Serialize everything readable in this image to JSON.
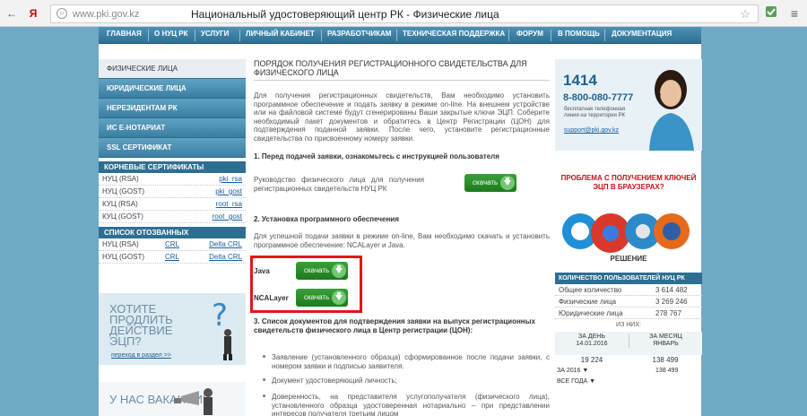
{
  "browser": {
    "back": "←",
    "ya": "Я",
    "url": "www.pki.gov.kz",
    "title": "Национальный удостоверяющий центр РК - Физические лица",
    "star": "☆",
    "menu": "≡"
  },
  "topnav": [
    "ГЛАВНАЯ",
    "О НУЦ РК",
    "УСЛУГИ",
    "ЛИЧНЫЙ КАБИНЕТ",
    "РАЗРАБОТЧИКАМ",
    "ТЕХНИЧЕСКАЯ ПОДДЕРЖКА",
    "ФОРУМ",
    "В ПОМОЩЬ",
    "ДОКУМЕНТАЦИЯ"
  ],
  "sidebar": {
    "menu": [
      "ФИЗИЧЕСКИЕ ЛИЦА",
      "ЮРИДИЧЕСКИЕ ЛИЦА",
      "НЕРЕЗИДЕНТАМ РК",
      "ИС Е-НОТАРИАТ",
      "SSL СЕРТИФИКАТ"
    ],
    "root_title": "КОРНЕВЫЕ СЕРТИФИКАТЫ",
    "root": [
      {
        "name": "НУЦ (RSA)",
        "link": "pki_rsa"
      },
      {
        "name": "НУЦ (GOST)",
        "link": "pki_gost"
      },
      {
        "name": "КУЦ (RSA)",
        "link": "root_rsa"
      },
      {
        "name": "КУЦ (GOST)",
        "link": "root_gost"
      }
    ],
    "revoked_title": "СПИСОК ОТОЗВАННЫХ СЕРТИФИКАТОВ",
    "revoked": [
      {
        "name": "НУЦ (RSA)",
        "crl": "CRL",
        "delta": "Delta CRL"
      },
      {
        "name": "НУЦ (GOST)",
        "crl": "CRL",
        "delta": "Delta CRL"
      }
    ],
    "promo1": {
      "text": "ХОТИТЕ ПРОДЛИТЬ ДЕЙСТВИЕ ЭЦП?",
      "link": "переход в раздел >>"
    },
    "promo2": {
      "text": "У НАС ВАКАНСИИ"
    }
  },
  "main": {
    "title": "ПОРЯДОК ПОЛУЧЕНИЯ РЕГИСТРАЦИОННОГО СВИДЕТЕЛЬСТВА ДЛЯ ФИЗИЧЕСКОГО ЛИЦА",
    "intro": "Для получения регистрационных свидетельств, Вам необходимо установить программное обеспечение и подать заявку в режиме on-line. На внешнем устройстве или на файловой системе будут сгенерированы Ваши закрытые ключи ЭЦП. Соберите необходимый пакет документов и обратитесь в Центр Регистрации (ЦОН) для подтверждения поданной заявки. После чего, установите регистрационные свидетельства по присвоенному номеру заявки.",
    "step1_title": "1. Перед подачей заявки, ознакомьтесь с инструкцией пользователя",
    "step1_text": "Руководство физического лица для получения регистрационных свидетельств НУЦ РК",
    "download_label": "скачать",
    "step2_title": "2. Установка программного обеспечения",
    "step2_text": "Для успешной подачи заявки в режиме on-line, Вам необходимо скачать и установить программное обеспечение: NCALayer и Java.",
    "java_label": "Java",
    "ncalayer_label": "NCALayer",
    "step3_title": "3. Список документов для подтверждения заявки на выпуск регистрационных свидетельств физического лица в Центр регистрации (ЦОН):",
    "bullets": [
      "Заявление (установленного образца) сформированное после подачи заявки, с номером заявки и подписью заявителя.",
      "Документ удостоверяющий личность;",
      "Доверенность, на представителя услугополучателя (физического лица), установленного образца удостоверенная нотариально – при представлении интересов получателя третьим лицом"
    ],
    "bullet3_link": "Доверенность"
  },
  "right": {
    "hotline_short": "1414",
    "hotline_long": "8-800-080-7777",
    "hotline_desc": "бесплатная телефонная линия на территории РК",
    "email": "support@pki.gov.kz",
    "problem": "ПРОБЛЕМА С ПОЛУЧЕНИЕМ КЛЮЧЕЙ ЭЦП В БРАУЗЕРАХ?",
    "solution": "РЕШЕНИЕ",
    "stats_title": "КОЛИЧЕСТВО ПОЛЬЗОВАТЕЛЕЙ НУЦ РК",
    "stats": [
      {
        "label": "Общее количество",
        "value": "3 614 482"
      },
      {
        "label": "Физические лица",
        "value": "3 269 246"
      },
      {
        "label": "Юридические лица",
        "value": "278 767"
      }
    ],
    "of_them": "ИЗ НИХ:",
    "per_day": "ЗА ДЕНЬ",
    "day_date": "14.01.2016",
    "per_month": "ЗА МЕСЯЦ",
    "month_name": "ЯНВАРЬ",
    "day_value": "19 224",
    "month_value": "138 499",
    "year_label": "ЗА 2016 ▼",
    "year_value": "138 499",
    "all_label": "ВСЕ ГОДА ▼"
  },
  "colors": {
    "nav": "#2d6f93",
    "accent_red": "#e01818",
    "download_green": "#2a8a2a"
  }
}
